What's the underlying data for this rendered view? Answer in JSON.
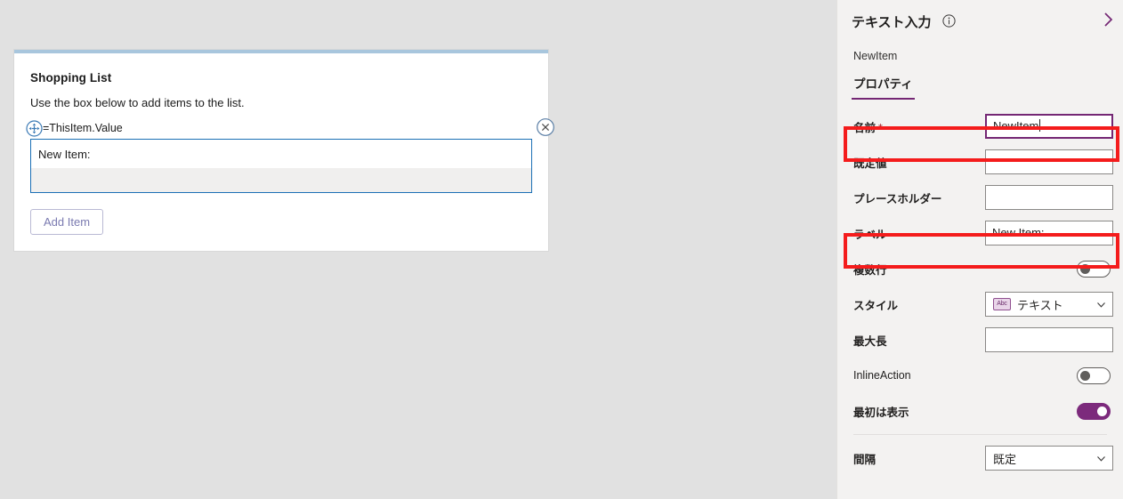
{
  "canvas": {
    "card": {
      "title": "Shopping List",
      "subtitle": "Use the box below to add items to the list.",
      "formula": "=ThisItem.Value",
      "input_label": "New Item:",
      "input_value": "",
      "button_label": "Add Item",
      "accent_color": "#a8c6dd",
      "selection_color": "#1a6fb5"
    },
    "background_color": "#e1e1e1"
  },
  "properties_pane": {
    "title": "テキスト入力",
    "subtitle": "NewItem",
    "info_icon": "info-icon",
    "collapse_icon": "chevron-right-icon",
    "tabs": [
      {
        "label": "プロパティ",
        "selected": true
      }
    ],
    "accent_color": "#742774",
    "highlight_color": "#f41c1c",
    "rows": [
      {
        "label": "名前",
        "required": true,
        "type": "text",
        "value": "NewItem",
        "focused": true,
        "highlighted": true
      },
      {
        "label": "既定値",
        "required": false,
        "type": "text",
        "value": "",
        "focused": false,
        "highlighted": false
      },
      {
        "label": "プレースホルダー",
        "required": false,
        "type": "text",
        "value": "",
        "focused": false,
        "highlighted": false
      },
      {
        "label": "ラベル",
        "required": false,
        "type": "text",
        "value": "New Item:",
        "focused": false,
        "highlighted": true
      },
      {
        "label": "複数行",
        "required": false,
        "type": "toggle",
        "value": "off"
      },
      {
        "label": "スタイル",
        "required": false,
        "type": "dropdown",
        "value": "テキスト",
        "icon": "abc-icon"
      },
      {
        "label": "最大長",
        "required": false,
        "type": "text",
        "value": "",
        "focused": false,
        "highlighted": false
      },
      {
        "label": "InlineAction",
        "required": false,
        "type": "toggle",
        "value": "off"
      },
      {
        "label": "最初は表示",
        "required": false,
        "type": "toggle",
        "value": "on"
      },
      {
        "label": "間隔",
        "required": false,
        "type": "dropdown",
        "value": "既定",
        "icon": ""
      }
    ]
  }
}
